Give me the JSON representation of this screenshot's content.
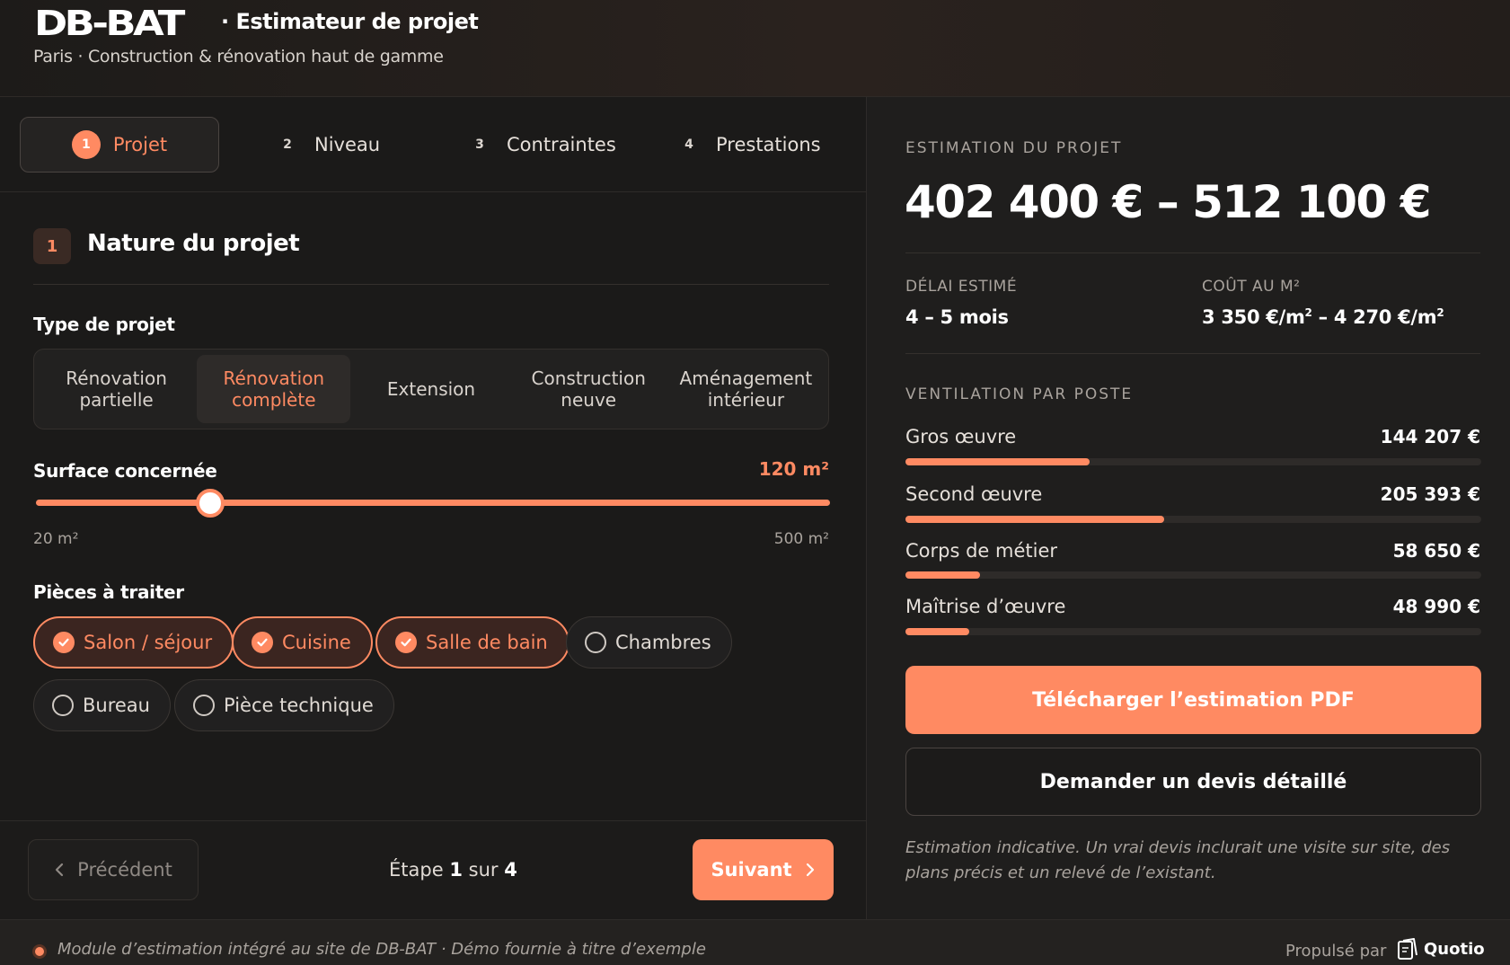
{
  "header": {
    "logo": "DB-BAT",
    "app_title": "· Estimateur de projet",
    "subtitle": "Paris · Construction & rénovation haut de gamme"
  },
  "steps": [
    {
      "num": "1",
      "label": "Projet",
      "active": true
    },
    {
      "num": "2",
      "label": "Niveau",
      "active": false
    },
    {
      "num": "3",
      "label": "Contraintes",
      "active": false
    },
    {
      "num": "4",
      "label": "Prestations",
      "active": false
    }
  ],
  "section": {
    "num": "1",
    "title": "Nature du projet"
  },
  "project_type": {
    "label": "Type de projet",
    "options": [
      {
        "label": "Rénovation\npartielle",
        "active": false
      },
      {
        "label": "Rénovation\ncomplète",
        "active": true
      },
      {
        "label": "Extension",
        "active": false
      },
      {
        "label": "Construction\nneuve",
        "active": false
      },
      {
        "label": "Aménagement\nintérieur",
        "active": false
      }
    ]
  },
  "surface": {
    "label": "Surface concernée",
    "value": "120 m²",
    "min_label": "20 m²",
    "max_label": "500 m²",
    "min": 20,
    "max": 500,
    "current": 120
  },
  "rooms": {
    "label": "Pièces à traiter",
    "items": [
      {
        "label": "Salon / séjour",
        "checked": true
      },
      {
        "label": "Cuisine",
        "checked": true
      },
      {
        "label": "Salle de bain",
        "checked": true
      },
      {
        "label": "Chambres",
        "checked": false
      },
      {
        "label": "Bureau",
        "checked": false
      },
      {
        "label": "Pièce technique",
        "checked": false
      }
    ]
  },
  "nav": {
    "prev_label": "Précédent",
    "step_prefix": "Étape",
    "step_current": "1",
    "step_mid": "sur",
    "step_total": "4",
    "next_label": "Suivant"
  },
  "estimate": {
    "eyebrow": "ESTIMATION DU PROJET",
    "total": "402 400 € – 512 100 €",
    "delay_label": "DÉLAI ESTIMÉ",
    "delay_value": "4 – 5 mois",
    "m2_label": "COÛT AU M²",
    "m2_value_a": "3 350 €/m",
    "m2_value_b": " – 4 270 €/m",
    "sup": "2",
    "breakdown_label": "VENTILATION PAR POSTE",
    "postes": [
      {
        "name": "Gros œuvre",
        "value": "144 207 €",
        "fraction": 0.32
      },
      {
        "name": "Second œuvre",
        "value": "205 393 €",
        "fraction": 0.45
      },
      {
        "name": "Corps de métier",
        "value": "58 650 €",
        "fraction": 0.13
      },
      {
        "name": "Maîtrise d’œuvre",
        "value": "48 990 €",
        "fraction": 0.11
      }
    ],
    "pdf_label": "Télécharger l’estimation PDF",
    "devis_label": "Demander un devis détaillé",
    "disclaimer": "Estimation indicative. Un vrai devis inclurait une visite sur site, des plans précis et un relevé de l’existant."
  },
  "footer": {
    "note": "Module d’estimation intégré au site de DB-BAT · Démo fournie à titre d’exemple",
    "powered": "Propulsé par",
    "brand": "Quotio"
  },
  "colors": {
    "accent": "#ff8a62",
    "bg": "#1b1a19",
    "panel": "#1f1e1d"
  }
}
